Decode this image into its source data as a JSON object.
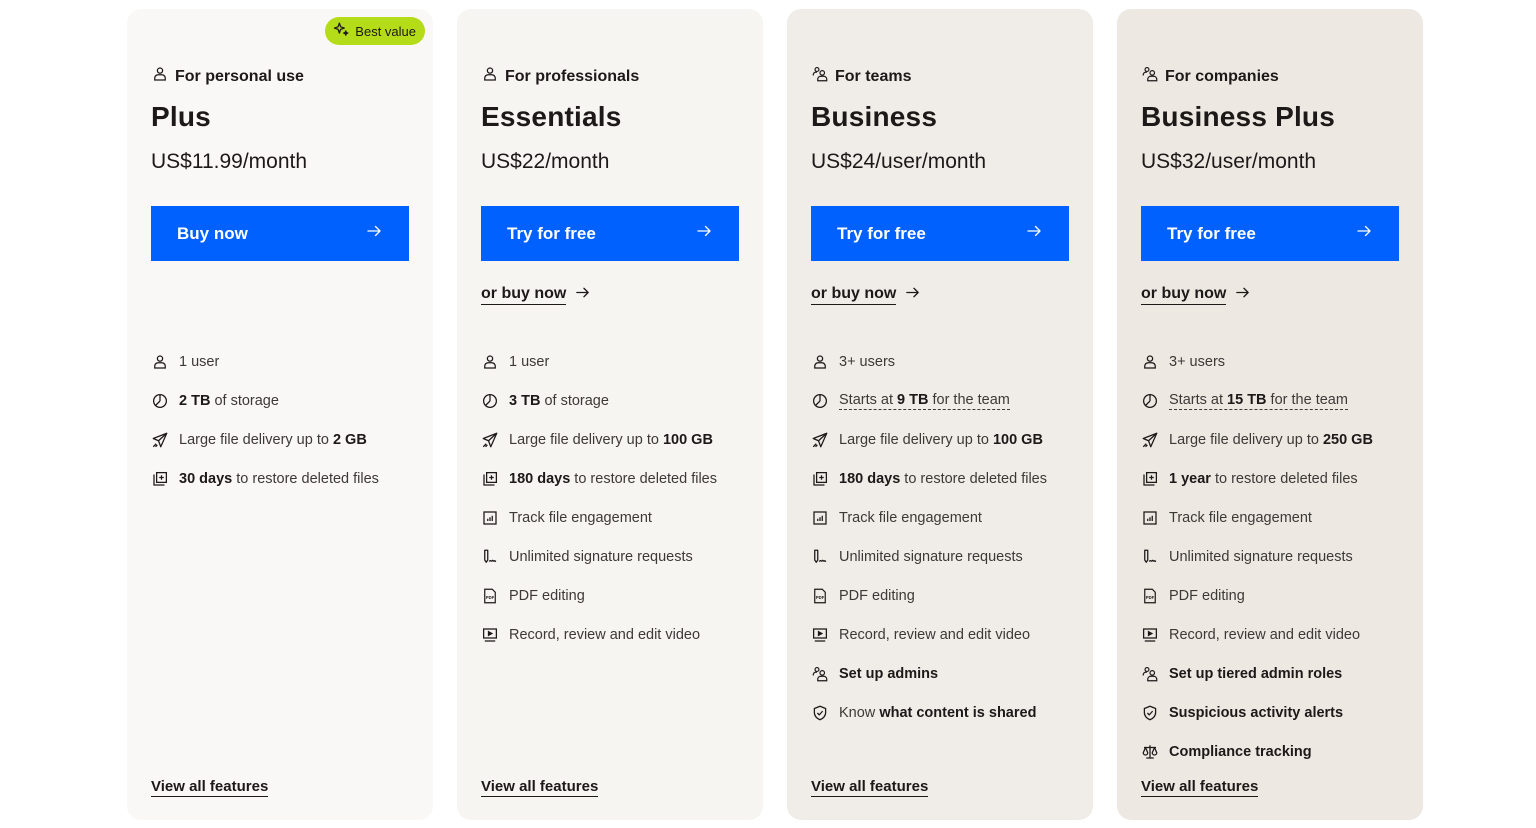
{
  "colors": {
    "primary_button": "#0061fe",
    "badge": "#b4dc19",
    "text": "#1e1919",
    "card_backgrounds": [
      "#f9f8f6",
      "#f6f5f2",
      "#f0ede8",
      "#ede8e2"
    ]
  },
  "plans": [
    {
      "badge": {
        "label": "Best value",
        "icon": "sparkle-icon"
      },
      "audience": {
        "label": "For personal use",
        "icon": "user-icon"
      },
      "name": "Plus",
      "price": "US$11.99/month",
      "cta": {
        "label": "Buy now",
        "icon": "arrow-right-icon"
      },
      "secondary": null,
      "features": [
        {
          "icon": "user-icon",
          "parts": [
            {
              "t": "1 user"
            }
          ]
        },
        {
          "icon": "storage-icon",
          "parts": [
            {
              "t": "2 TB",
              "b": true
            },
            {
              "t": " of storage"
            }
          ]
        },
        {
          "icon": "send-icon",
          "parts": [
            {
              "t": "Large file delivery up to "
            },
            {
              "t": "2 GB",
              "b": true
            }
          ]
        },
        {
          "icon": "restore-icon",
          "parts": [
            {
              "t": "30 days",
              "b": true
            },
            {
              "t": " to restore deleted files"
            }
          ]
        }
      ],
      "view_all": "View all features"
    },
    {
      "badge": null,
      "audience": {
        "label": "For professionals",
        "icon": "user-icon"
      },
      "name": "Essentials",
      "price": "US$22/month",
      "cta": {
        "label": "Try for free",
        "icon": "arrow-right-icon"
      },
      "secondary": {
        "label": "or buy now",
        "icon": "arrow-right-icon"
      },
      "features": [
        {
          "icon": "user-icon",
          "parts": [
            {
              "t": "1 user"
            }
          ]
        },
        {
          "icon": "storage-icon",
          "parts": [
            {
              "t": "3 TB",
              "b": true
            },
            {
              "t": " of storage"
            }
          ]
        },
        {
          "icon": "send-icon",
          "parts": [
            {
              "t": "Large file delivery up to "
            },
            {
              "t": "100 GB",
              "b": true
            }
          ]
        },
        {
          "icon": "restore-icon",
          "parts": [
            {
              "t": "180 days",
              "b": true
            },
            {
              "t": " to restore deleted files"
            }
          ]
        },
        {
          "icon": "chart-icon",
          "parts": [
            {
              "t": "Track file engagement"
            }
          ]
        },
        {
          "icon": "signature-icon",
          "parts": [
            {
              "t": "Unlimited signature requests"
            }
          ]
        },
        {
          "icon": "pdf-icon",
          "parts": [
            {
              "t": "PDF editing"
            }
          ]
        },
        {
          "icon": "video-icon",
          "parts": [
            {
              "t": "Record, review and edit video"
            }
          ]
        }
      ],
      "view_all": "View all features"
    },
    {
      "badge": null,
      "audience": {
        "label": "For teams",
        "icon": "team-icon"
      },
      "name": "Business",
      "price": "US$24/user/month",
      "cta": {
        "label": "Try for free",
        "icon": "arrow-right-icon"
      },
      "secondary": {
        "label": "or buy now",
        "icon": "arrow-right-icon"
      },
      "features": [
        {
          "icon": "user-icon",
          "parts": [
            {
              "t": "3+ users"
            }
          ]
        },
        {
          "icon": "storage-icon",
          "dotted": true,
          "parts": [
            {
              "t": "Starts at "
            },
            {
              "t": "9 TB",
              "b": true
            },
            {
              "t": " for the team"
            }
          ]
        },
        {
          "icon": "send-icon",
          "parts": [
            {
              "t": "Large file delivery up to "
            },
            {
              "t": "100 GB",
              "b": true
            }
          ]
        },
        {
          "icon": "restore-icon",
          "parts": [
            {
              "t": "180 days",
              "b": true
            },
            {
              "t": " to restore deleted files"
            }
          ]
        },
        {
          "icon": "chart-icon",
          "parts": [
            {
              "t": "Track file engagement"
            }
          ]
        },
        {
          "icon": "signature-icon",
          "parts": [
            {
              "t": "Unlimited signature requests"
            }
          ]
        },
        {
          "icon": "pdf-icon",
          "parts": [
            {
              "t": "PDF editing"
            }
          ]
        },
        {
          "icon": "video-icon",
          "parts": [
            {
              "t": "Record, review and edit video"
            }
          ]
        },
        {
          "icon": "team-icon",
          "parts": [
            {
              "t": "Set up admins",
              "b": true
            }
          ]
        },
        {
          "icon": "shield-icon",
          "parts": [
            {
              "t": "Know "
            },
            {
              "t": "what content is shared",
              "b": true
            }
          ]
        }
      ],
      "view_all": "View all features"
    },
    {
      "badge": null,
      "audience": {
        "label": "For companies",
        "icon": "team-icon"
      },
      "name": "Business Plus",
      "price": "US$32/user/month",
      "cta": {
        "label": "Try for free",
        "icon": "arrow-right-icon"
      },
      "secondary": {
        "label": "or buy now",
        "icon": "arrow-right-icon"
      },
      "features": [
        {
          "icon": "user-icon",
          "parts": [
            {
              "t": "3+ users"
            }
          ]
        },
        {
          "icon": "storage-icon",
          "dotted": true,
          "parts": [
            {
              "t": "Starts at "
            },
            {
              "t": "15 TB",
              "b": true
            },
            {
              "t": " for the team"
            }
          ]
        },
        {
          "icon": "send-icon",
          "parts": [
            {
              "t": "Large file delivery up to "
            },
            {
              "t": "250 GB",
              "b": true
            }
          ]
        },
        {
          "icon": "restore-icon",
          "parts": [
            {
              "t": "1 year",
              "b": true
            },
            {
              "t": " to restore deleted files"
            }
          ]
        },
        {
          "icon": "chart-icon",
          "parts": [
            {
              "t": "Track file engagement"
            }
          ]
        },
        {
          "icon": "signature-icon",
          "parts": [
            {
              "t": "Unlimited signature requests"
            }
          ]
        },
        {
          "icon": "pdf-icon",
          "parts": [
            {
              "t": "PDF editing"
            }
          ]
        },
        {
          "icon": "video-icon",
          "parts": [
            {
              "t": "Record, review and edit video"
            }
          ]
        },
        {
          "icon": "team-icon",
          "parts": [
            {
              "t": "Set up tiered admin roles",
              "b": true
            }
          ]
        },
        {
          "icon": "shield-icon",
          "parts": [
            {
              "t": "Suspicious activity alerts",
              "b": true
            }
          ]
        },
        {
          "icon": "scale-icon",
          "parts": [
            {
              "t": "Compliance tracking",
              "b": true
            }
          ]
        }
      ],
      "view_all": "View all features"
    }
  ]
}
